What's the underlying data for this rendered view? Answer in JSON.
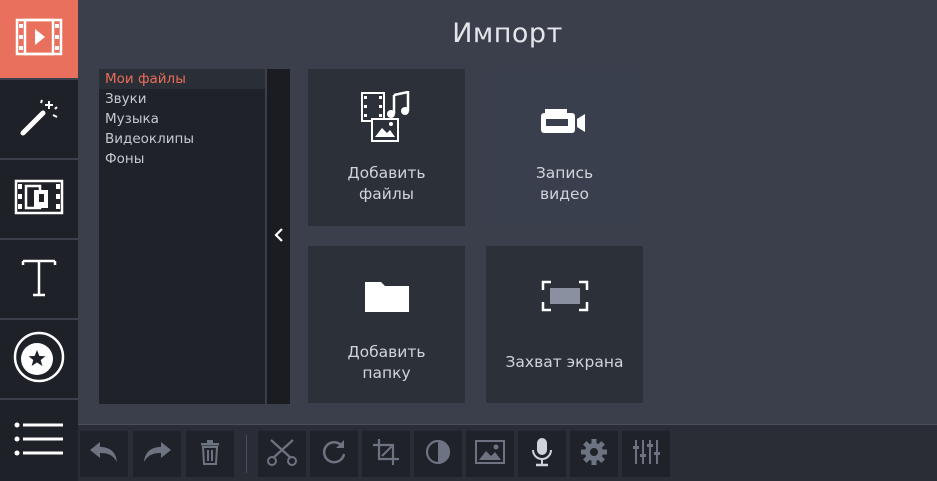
{
  "title": "Импорт",
  "sidebar": {
    "items": [
      {
        "name": "import",
        "icon": "film-import-icon",
        "active": true
      },
      {
        "name": "filters",
        "icon": "magic-wand-icon",
        "active": false
      },
      {
        "name": "transitions",
        "icon": "transition-film-icon",
        "active": false
      },
      {
        "name": "titles",
        "icon": "text-icon",
        "active": false
      },
      {
        "name": "stickers",
        "icon": "sticker-star-icon",
        "active": false
      },
      {
        "name": "more",
        "icon": "menu-list-icon",
        "active": false
      }
    ]
  },
  "file_list": {
    "items": [
      "Мои файлы",
      "Звуки",
      "Музыка",
      "Видеоклипы",
      "Фоны"
    ],
    "selected_index": 0
  },
  "tiles": {
    "add_files": "Добавить\nфайлы",
    "record_video": "Запись\nвидео",
    "add_folder": "Добавить\nпапку",
    "screen_capture": "Захват экрана"
  },
  "colors": {
    "accent": "#e8705c",
    "background": "#3a3f4b",
    "panel": "#1f2229"
  },
  "toolbar": {
    "buttons": [
      "undo-icon",
      "redo-icon",
      "trash-icon",
      "scissors-icon",
      "rotate-icon",
      "crop-icon",
      "color-adjust-icon",
      "image-icon",
      "microphone-icon",
      "settings-gear-icon",
      "equalizer-icon"
    ]
  }
}
